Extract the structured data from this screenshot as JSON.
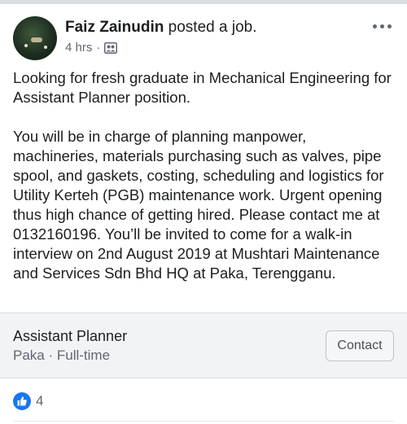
{
  "post": {
    "author": "Faiz Zainudin",
    "action": "posted a job.",
    "time": "4 hrs",
    "separator": "·",
    "audience_icon": "group-icon",
    "paragraphs": [
      "Looking for fresh graduate in Mechanical Engineering for Assistant Planner position.",
      "You will be in charge of planning manpower, machineries, materials purchasing such as valves, pipe spool, and gaskets, costing,  scheduling and logistics for Utility Kerteh (PGB) maintenance work. Urgent opening thus high chance of getting hired. Please contact me at 0132160196. You’ll be invited to come for a walk-in interview on 2nd August 2019 at Mushtari Maintenance and Services Sdn Bhd HQ at Paka, Terengganu."
    ]
  },
  "job": {
    "title": "Assistant Planner",
    "location_type": "Paka · Full-time",
    "contact_label": "Contact"
  },
  "reactions": {
    "icon": "like-icon",
    "count": "4"
  },
  "colors": {
    "like_blue": "#1877f2",
    "card_bg": "#f2f3f5",
    "secondary_text": "#606770"
  }
}
